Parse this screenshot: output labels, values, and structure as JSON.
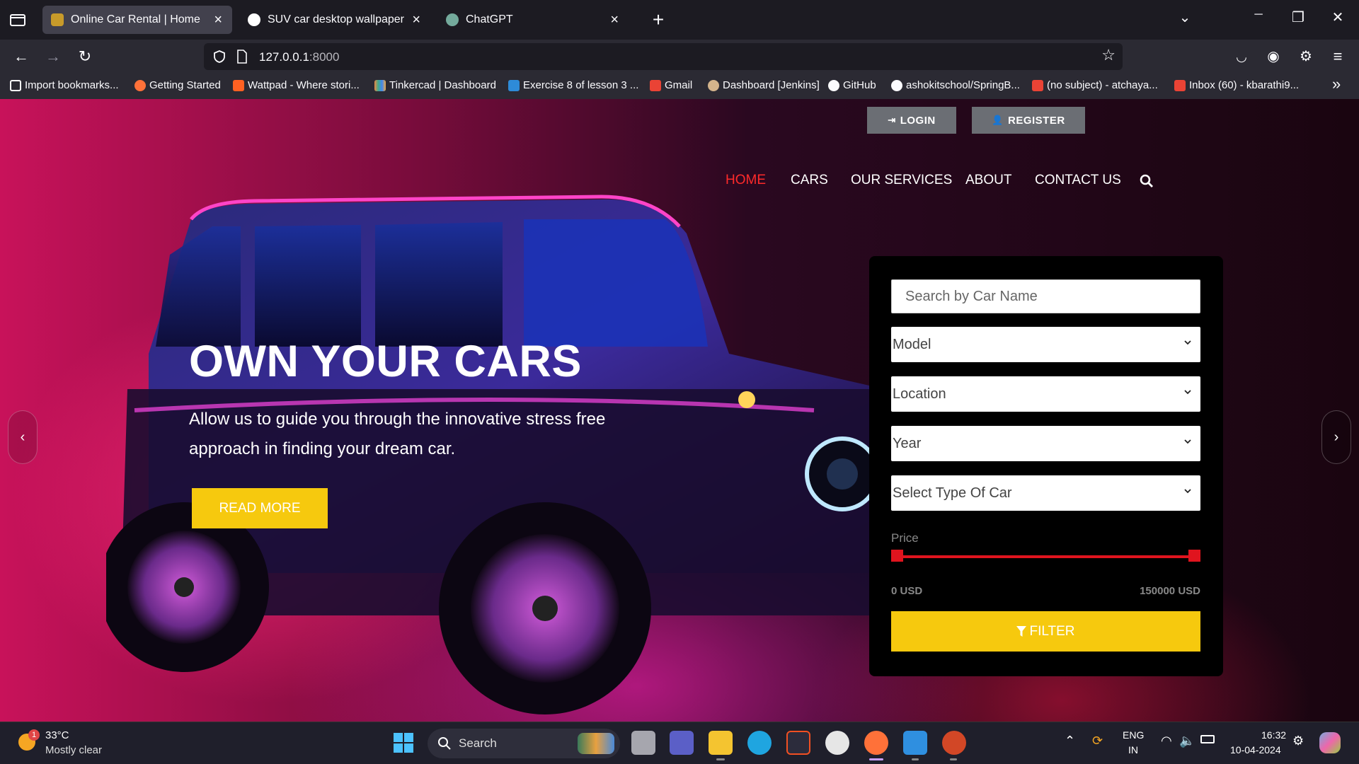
{
  "browser": {
    "tabs": [
      {
        "title": "Online Car Rental | Home",
        "close": "×"
      },
      {
        "title": "SUV car desktop wallpaper - Go",
        "close": "×"
      },
      {
        "title": "ChatGPT",
        "close": "×"
      }
    ],
    "new_tab": "+",
    "window_controls": {
      "list": "⌄",
      "minimize": "─",
      "restore": "❐",
      "close": "✕"
    },
    "url": {
      "host": "127.0.0.1",
      "port": ":8000"
    },
    "bookmarks": [
      "Import bookmarks...",
      "Getting Started",
      "Wattpad - Where stori...",
      "Tinkercad | Dashboard",
      "Exercise 8 of lesson 3 ...",
      "Gmail",
      "Dashboard [Jenkins]",
      "GitHub",
      "ashokitschool/SpringB...",
      "(no subject) - atchaya...",
      "Inbox (60) - kbarathi9..."
    ],
    "bookmarks_overflow": "»"
  },
  "site": {
    "auth": {
      "login": "LOGIN",
      "register": "REGISTER"
    },
    "menu": [
      "HOME",
      "CARS",
      "OUR SERVICES",
      "ABOUT",
      "CONTACT US"
    ],
    "hero": {
      "title": "OWN YOUR CARS",
      "subtitle": "Allow us to guide you through the innovative stress free approach in finding your dream car.",
      "cta": "READ MORE"
    },
    "carousel": {
      "prev": "‹",
      "next": "›"
    },
    "filter": {
      "search_placeholder": "Search by Car Name",
      "selects": [
        "Model",
        "Location",
        "Year",
        "Select Type Of Car"
      ],
      "price_label": "Price",
      "price_min": "0 USD",
      "price_max": "150000 USD",
      "price_range": {
        "low": 0,
        "high": 150000
      },
      "button": "FILTER"
    },
    "colors": {
      "accent_yellow": "#f6c90e",
      "active_red": "#ff2a2a",
      "slider_red": "#e0141e"
    }
  },
  "taskbar": {
    "weather": {
      "temp": "33°C",
      "desc": "Mostly clear",
      "badge": "1"
    },
    "search": "Search",
    "tray": {
      "lang1": "ENG",
      "lang2": "IN",
      "time": "16:32",
      "date": "10-04-2024"
    }
  }
}
